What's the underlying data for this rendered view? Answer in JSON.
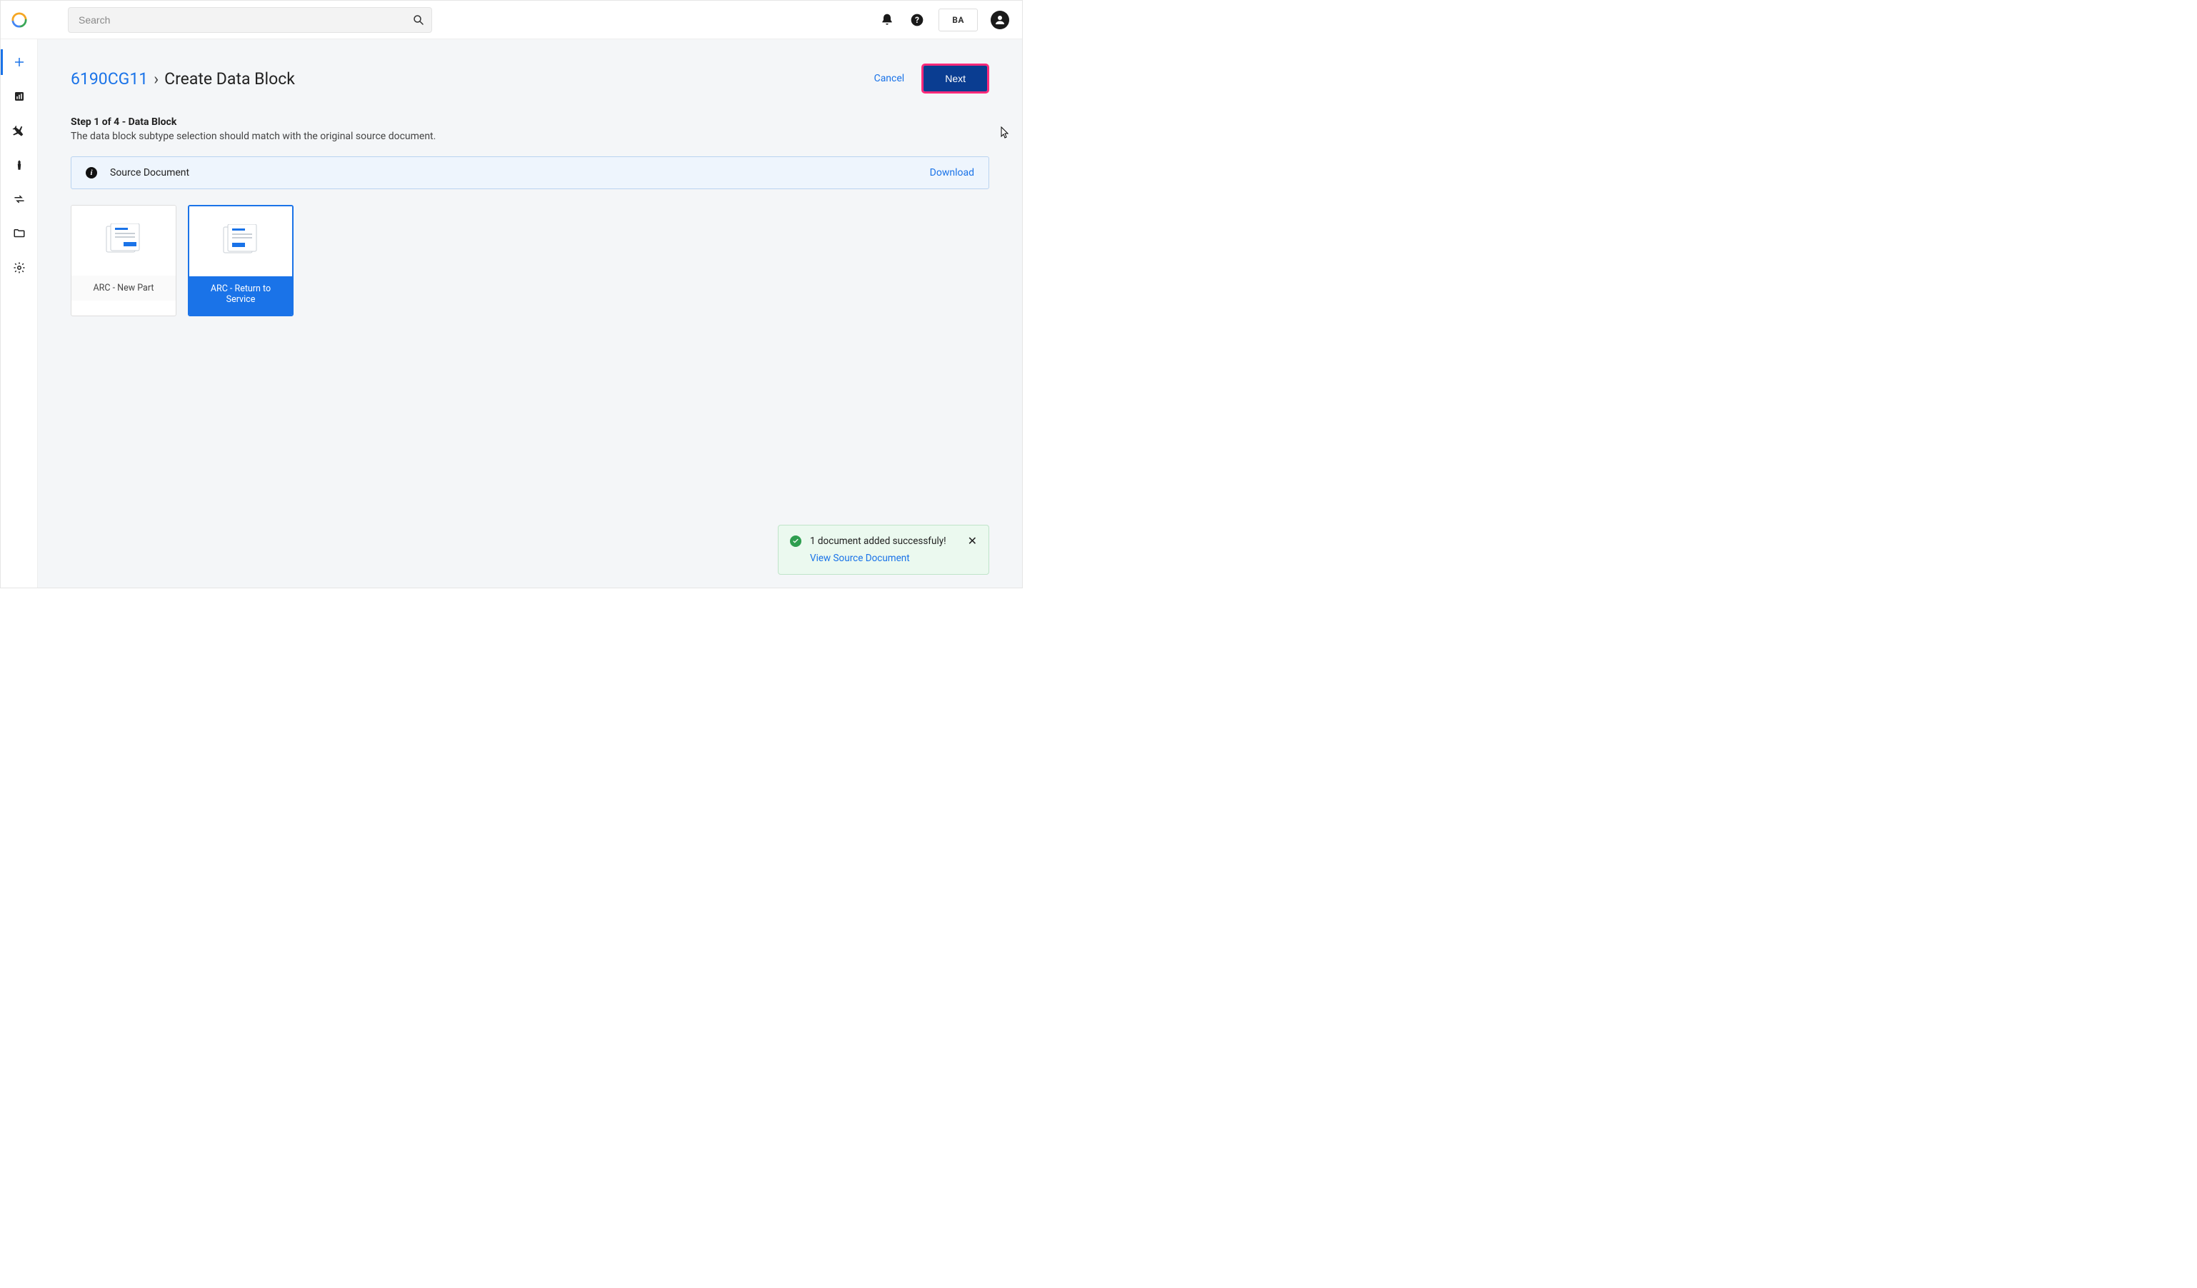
{
  "header": {
    "search_placeholder": "Search",
    "user_initials": "BA"
  },
  "breadcrumb": {
    "link": "6190CG11",
    "separator": "›",
    "current": "Create Data Block"
  },
  "actions": {
    "cancel": "Cancel",
    "next": "Next"
  },
  "step": {
    "title": "Step 1 of 4 - Data Block",
    "description": "The data block subtype selection should match with the original source document."
  },
  "source_banner": {
    "label": "Source Document",
    "download": "Download"
  },
  "cards": [
    {
      "label": "ARC - New Part",
      "selected": false
    },
    {
      "label": "ARC - Return to Service",
      "selected": true
    }
  ],
  "toast": {
    "message": "1 document added successfuly!",
    "link": "View Source Document"
  }
}
